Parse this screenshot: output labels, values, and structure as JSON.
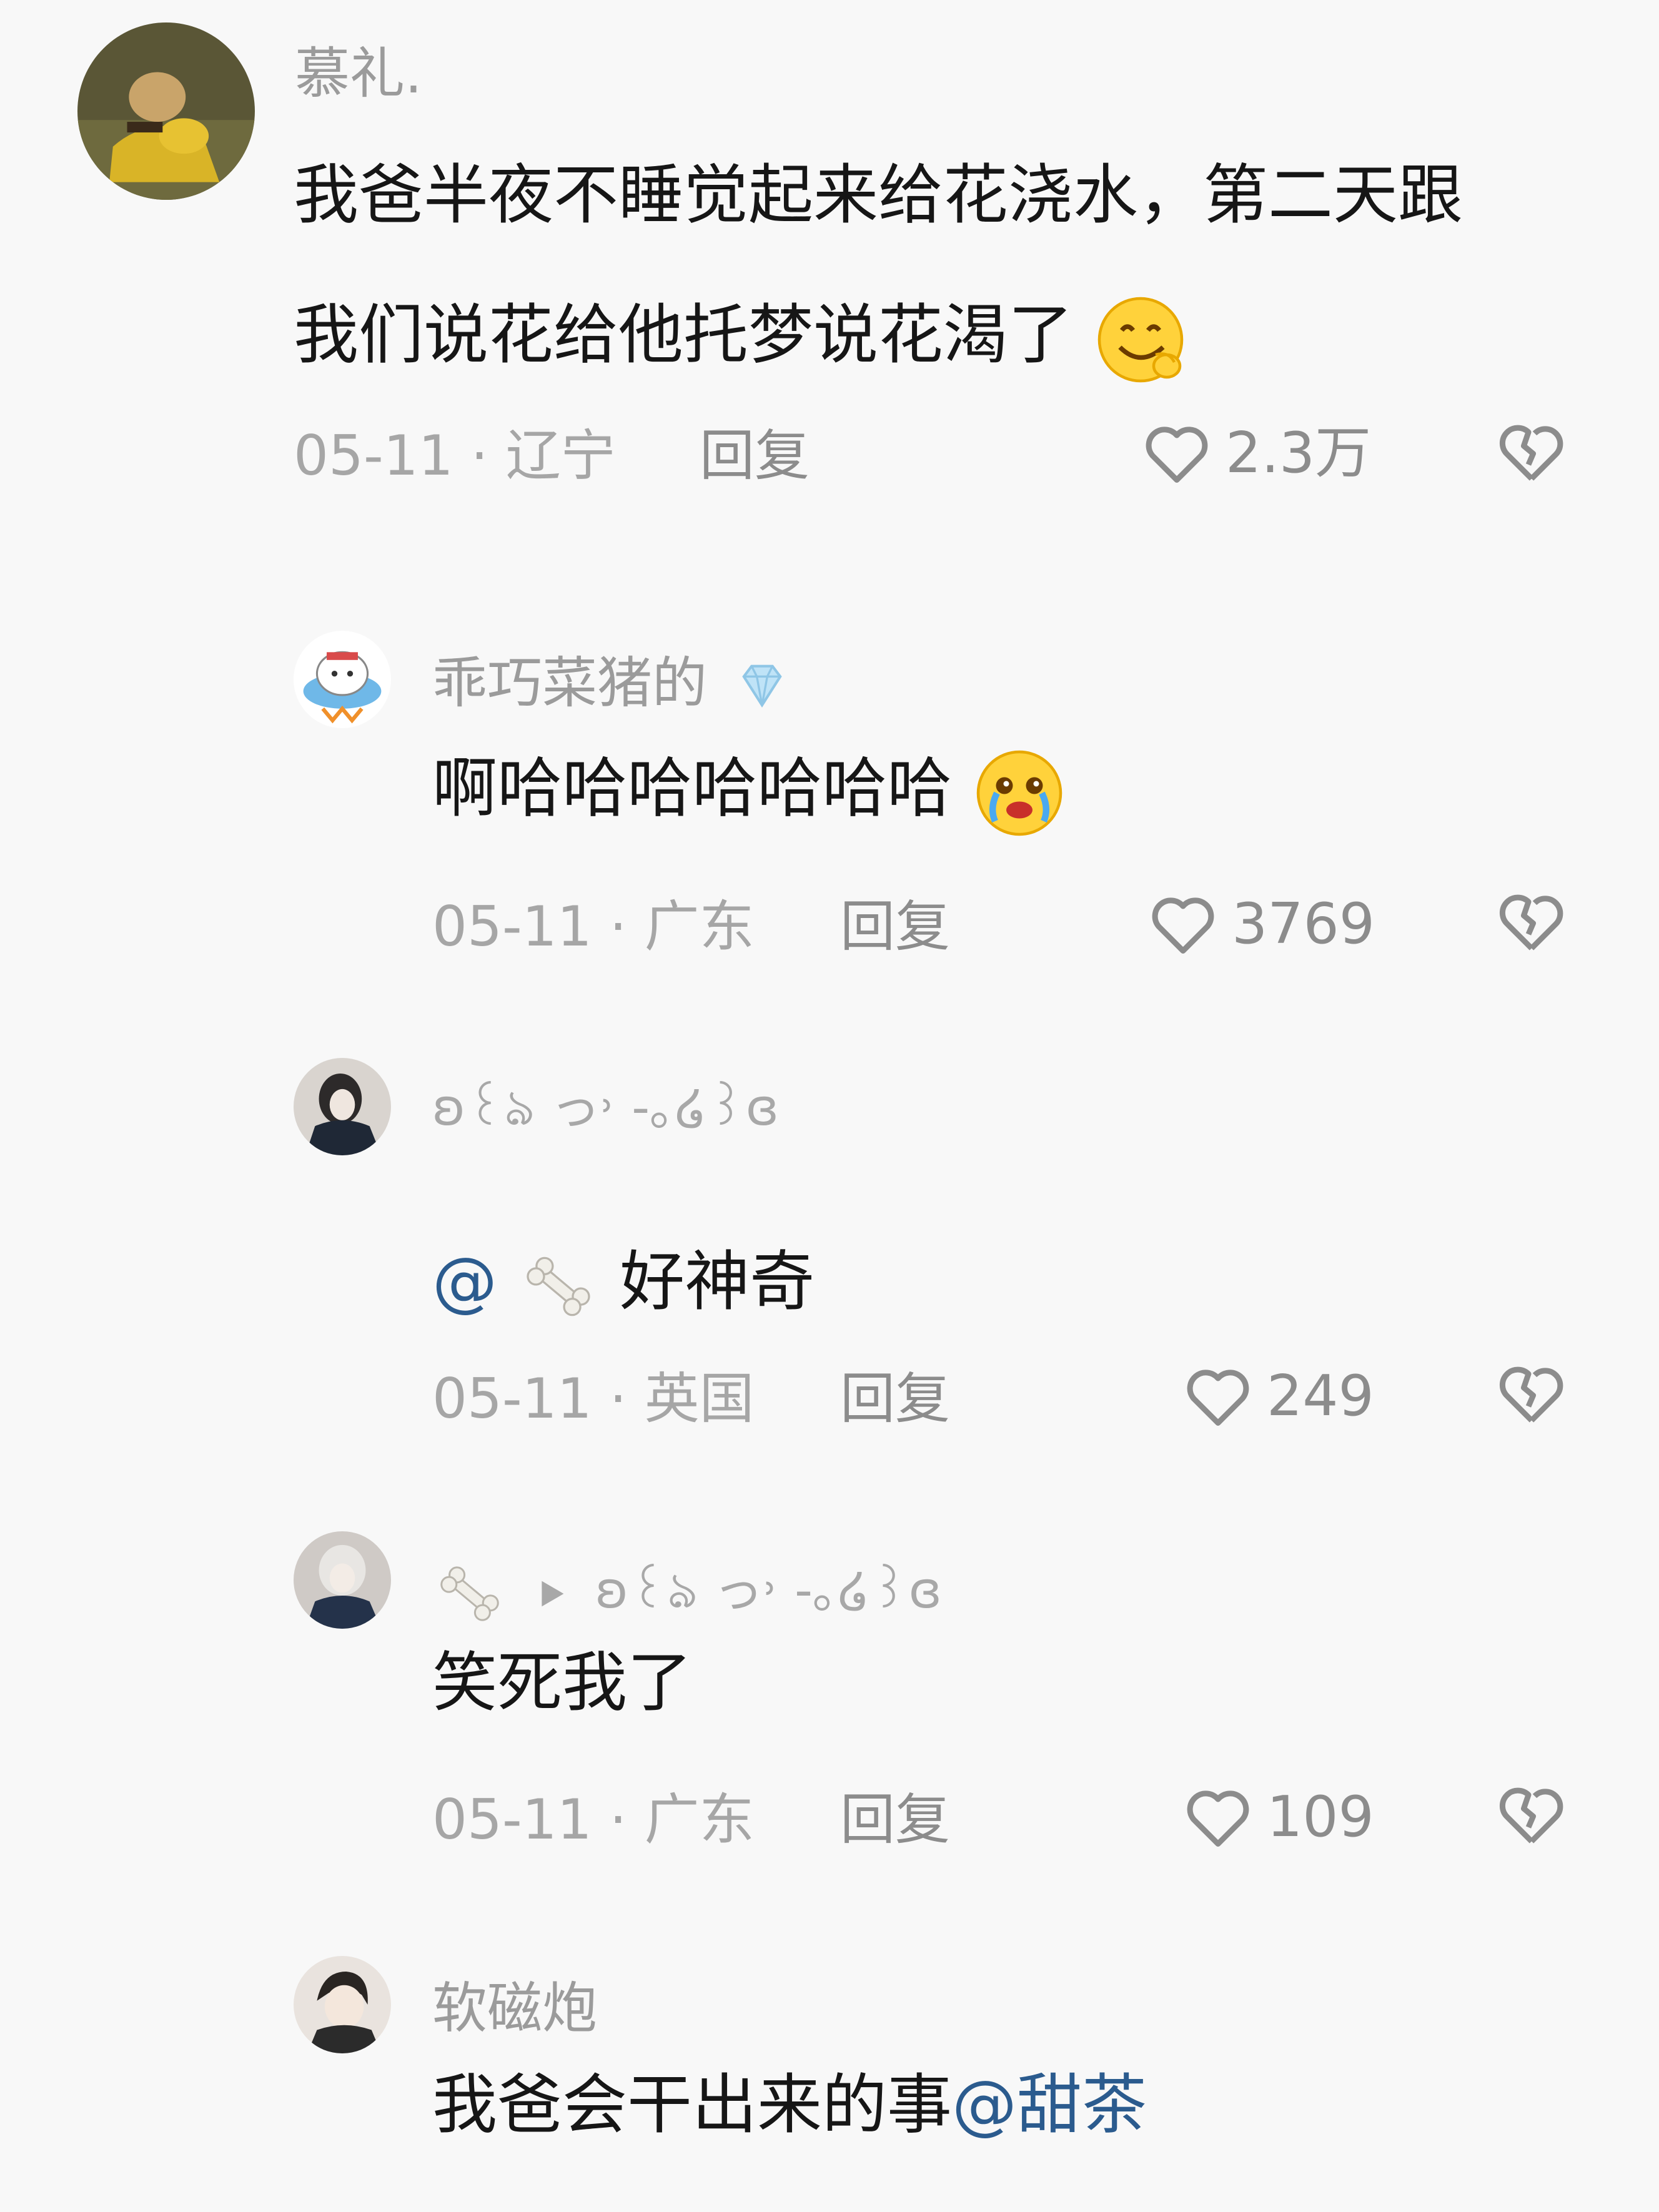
{
  "comments": [
    {
      "username": "慕礼.",
      "text_line1": "我爸半夜不睡觉起来给花浇水，第二天跟",
      "text_line2": "我们说花给他托梦说花渴了",
      "date_location": "05-11 · 辽宁",
      "reply": "回复",
      "likes": "2.3万"
    },
    {
      "username": "乖巧菜猪的",
      "text": "啊哈哈哈哈哈哈哈",
      "date_location": "05-11 · 广东",
      "reply": "回复",
      "likes": "3769"
    },
    {
      "username": "ʚ꒰ঌ っ˒ -｡໒꒱ɞ",
      "mention": "@",
      "text": " 好神奇",
      "date_location": "05-11 · 英国",
      "reply": "回复",
      "likes": "249"
    },
    {
      "username": "ʚ꒰ঌ っ˒ -｡໒꒱ɞ",
      "text": "笑死我了",
      "date_location": "05-11 · 广东",
      "reply": "回复",
      "likes": "109"
    },
    {
      "username": "软磁炮",
      "text": "我爸会干出来的事",
      "mention": "@甜茶"
    }
  ],
  "icons": {
    "like": "heart-outline-icon",
    "dislike": "broken-heart-icon",
    "emoji_1": "drooling-face-emoji",
    "emoji_2": "crying-laughing-emoji",
    "badge": "diamond-icon",
    "bone": "bone-icon",
    "reply_arrow": "play-arrow-icon"
  },
  "colors": {
    "background": "#f8f8f8",
    "text": "#161616",
    "muted": "#9b9b9b",
    "mention": "#2b5b8e"
  }
}
